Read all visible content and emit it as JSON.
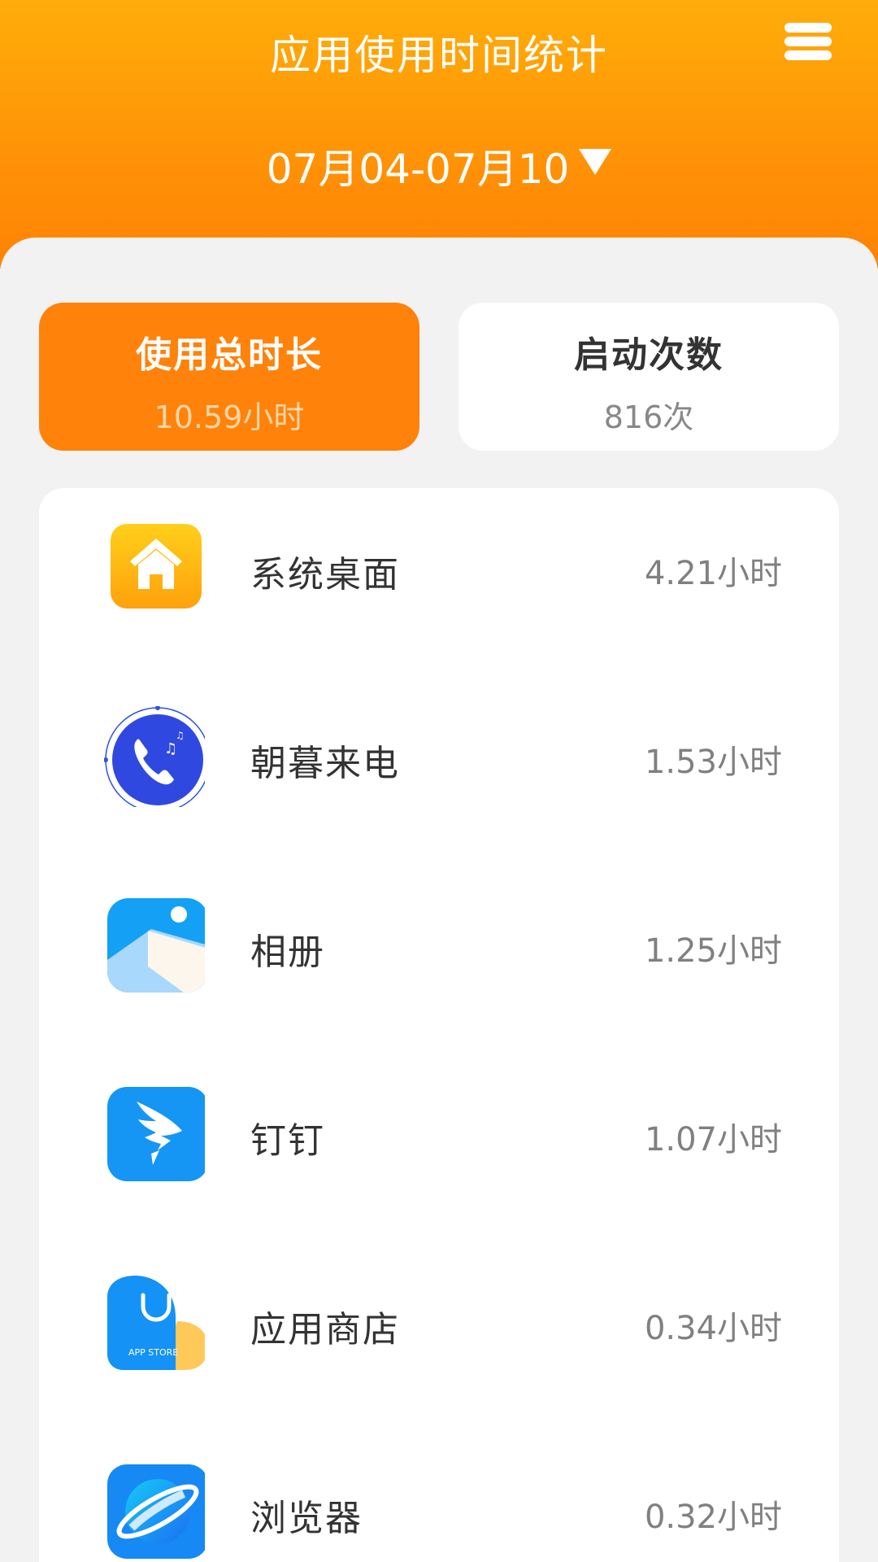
{
  "header": {
    "title": "应用使用时间统计",
    "date_range": "07月04-07月10",
    "accent_color": "#ff8a05"
  },
  "tabs": [
    {
      "label": "使用总时长",
      "value": "10.59小时",
      "selected": true
    },
    {
      "label": "启动次数",
      "value": "816次",
      "selected": false
    }
  ],
  "apps": [
    {
      "name": "系统桌面",
      "time": "4.21小时",
      "icon": "home-icon"
    },
    {
      "name": "朝暮来电",
      "time": "1.53小时",
      "icon": "phone-music-icon"
    },
    {
      "name": "相册",
      "time": "1.25小时",
      "icon": "gallery-icon"
    },
    {
      "name": "钉钉",
      "time": "1.07小时",
      "icon": "dingtalk-icon"
    },
    {
      "name": "应用商店",
      "time": "0.34小时",
      "icon": "app-store-icon",
      "icon_text": "APP STORE"
    },
    {
      "name": "浏览器",
      "time": "0.32小时",
      "icon": "browser-icon"
    }
  ]
}
